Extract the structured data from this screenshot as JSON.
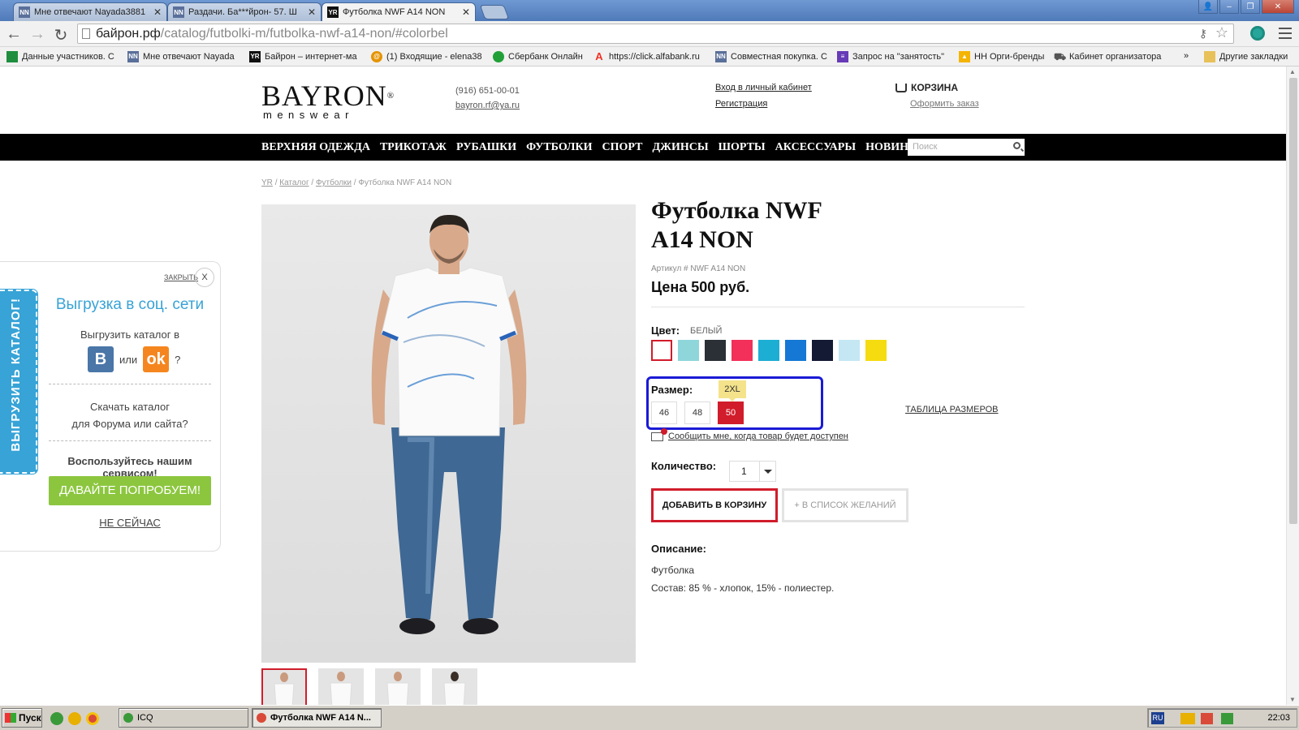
{
  "browser": {
    "tabs": [
      {
        "title": "Мне отвечают Nayada3881",
        "icon": "nn-favicon"
      },
      {
        "title": "Раздачи. Ба***йрон- 57. Ш",
        "icon": "nn-favicon"
      },
      {
        "title": "Футболка NWF A14 NON",
        "icon": "yr-favicon",
        "active": true
      }
    ],
    "url_host": "байрон.рф",
    "url_path": "/catalog/futbolki-m/futbolka-nwf-a14-non/#colorbel",
    "bookmarks": [
      "Данные участников. С",
      "Мне отвечают Nayada",
      "Байрон – интернет-ма",
      "(1) Входящие - elena38",
      "Сбербанк Онлайн",
      "https://click.alfabank.ru",
      "Совместная покупка. С",
      "Запрос на \"занятость\"",
      "НН Орги-бренды",
      "Кабинет организатора"
    ],
    "bookmarks_more": "»",
    "other_bookmarks": "Другие закладки"
  },
  "header": {
    "logo_main": "BAYRON",
    "logo_reg": "®",
    "logo_sub": "menswear",
    "phone": "(916) 651-00-01",
    "email": "bayron.rf@ya.ru",
    "login": "Вход в личный кабинет",
    "register": "Регистрация",
    "cart": "КОРЗИНА",
    "checkout": "Оформить заказ"
  },
  "nav": {
    "items": [
      "ВЕРХНЯЯ ОДЕЖДА",
      "ТРИКОТАЖ",
      "РУБАШКИ",
      "ФУТБОЛКИ",
      "СПОРТ",
      "ДЖИНСЫ",
      "ШОРТЫ",
      "АКСЕССУАРЫ",
      "НОВИНКИ"
    ],
    "search_placeholder": "Поиск"
  },
  "breadcrumb": {
    "home": "YR",
    "catalog": "Каталог",
    "category": "Футболки",
    "current": "Футболка NWF A14 NON",
    "sep": "/"
  },
  "product": {
    "title_line1": "Футболка NWF",
    "title_line2": "A14 NON",
    "sku": "Артикул # NWF A14 NON",
    "price": "Цена 500 руб.",
    "color_label": "Цвет:",
    "color_value": "БЕЛЫЙ",
    "colors": [
      "#ffffff",
      "#8fd6db",
      "#2b2f36",
      "#f2305a",
      "#1daed4",
      "#1478d4",
      "#141a33",
      "#c4e7f3",
      "#f5dc10"
    ],
    "size_label": "Размер:",
    "size_tooltip": "2XL",
    "sizes": [
      "46",
      "48",
      "50"
    ],
    "size_selected": "50",
    "size_table": "ТАБЛИЦА РАЗМЕРОВ",
    "notify": "Сообщить мне, когда товар будет доступен",
    "qty_label": "Количество:",
    "qty_value": "1",
    "add_to_cart": "ДОБАВИТЬ В КОРЗИНУ",
    "wishlist": "+ В СПИСОК ЖЕЛАНИЙ",
    "desc_label": "Описание:",
    "desc_line1": "Футболка",
    "desc_line2": "Состав: 85 % - хлопок, 15% - полиестер."
  },
  "widget": {
    "tab": "ВЫГРУЗИТЬ КАТАЛОГ!",
    "close_label": "ЗАКРЫТЬ",
    "close_x": "X",
    "title": "Выгрузка в соц. сети",
    "subtitle": "Выгрузить каталог в",
    "vk": "В",
    "or": "или",
    "ok": "ok",
    "question": "?",
    "download_line1": "Скачать каталог",
    "download_line2": "для Форума или сайта?",
    "use_service": "Воспользуйтесь нашим сервисом!",
    "try_btn": "ДАВАЙТЕ ПОПРОБУЕМ!",
    "not_now": "НЕ СЕЙЧАС"
  },
  "taskbar": {
    "start": "Пуск",
    "tasks": [
      "ICQ",
      "Футболка NWF A14 N..."
    ],
    "lang": "RU",
    "clock": "22:03"
  }
}
